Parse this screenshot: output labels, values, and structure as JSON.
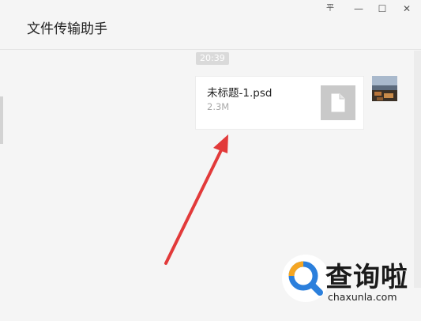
{
  "window": {
    "title": "文件传输助手",
    "controls": [
      {
        "name": "pin-icon",
        "glyph": "平"
      },
      {
        "name": "minimize-icon",
        "glyph": "—"
      },
      {
        "name": "maximize-icon",
        "glyph": "☐"
      },
      {
        "name": "close-icon",
        "glyph": "✕"
      }
    ]
  },
  "chat": {
    "timestamp": "20:39",
    "message": {
      "file_name": "未标题-1.psd",
      "file_size": "2.3M",
      "file_icon": "document-icon"
    },
    "avatar": "user-avatar"
  },
  "annotation": {
    "arrow_color": "#e23a3a",
    "arrow_icon": "red-arrow-icon"
  },
  "watermark": {
    "logo_text": "查询啦",
    "url": "chaxunla.com",
    "accent_color": "#2b7fdc",
    "secondary_color": "#f5a623"
  }
}
